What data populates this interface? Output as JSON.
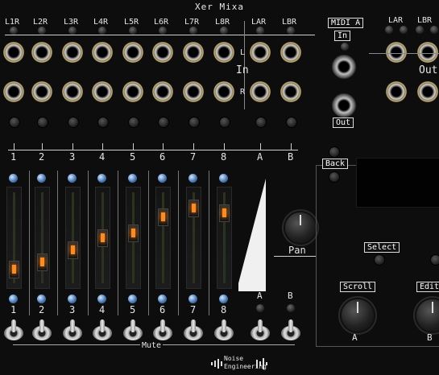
{
  "module": {
    "title": "Xer Mixa",
    "input_labels": [
      "L1R",
      "L2R",
      "L3R",
      "L4R",
      "L5R",
      "L6R",
      "L7R",
      "L8R",
      "LAR",
      "LBR"
    ],
    "right_section_label": "LAR",
    "right_section_label2": "LBR",
    "l_marker": "L",
    "r_marker": "R",
    "in_label": "In",
    "out_label": "Out",
    "midi_label": "MIDI A",
    "midi_in_label": "In",
    "midi_out_label": "Out",
    "channel_numbers": [
      "1",
      "2",
      "3",
      "4",
      "5",
      "6",
      "7",
      "8",
      "A",
      "B"
    ],
    "fader_numbers": [
      "1",
      "2",
      "3",
      "4",
      "5",
      "6",
      "7",
      "8"
    ],
    "ab_labels": [
      "A",
      "B"
    ],
    "fader_levels": [
      0.12,
      0.2,
      0.35,
      0.5,
      0.55,
      0.75,
      0.85,
      0.8
    ],
    "pan_label": "Pan",
    "back_label": "Back",
    "select_label": "Select",
    "scroll_label": "Scroll",
    "edit_label": "Edit",
    "knob_a_label": "A",
    "knob_b_label": "B",
    "mute_label": "Mute",
    "brand_line1": "Noise",
    "brand_line2": "Engineering",
    "accent_color": "#ff8a1e"
  }
}
